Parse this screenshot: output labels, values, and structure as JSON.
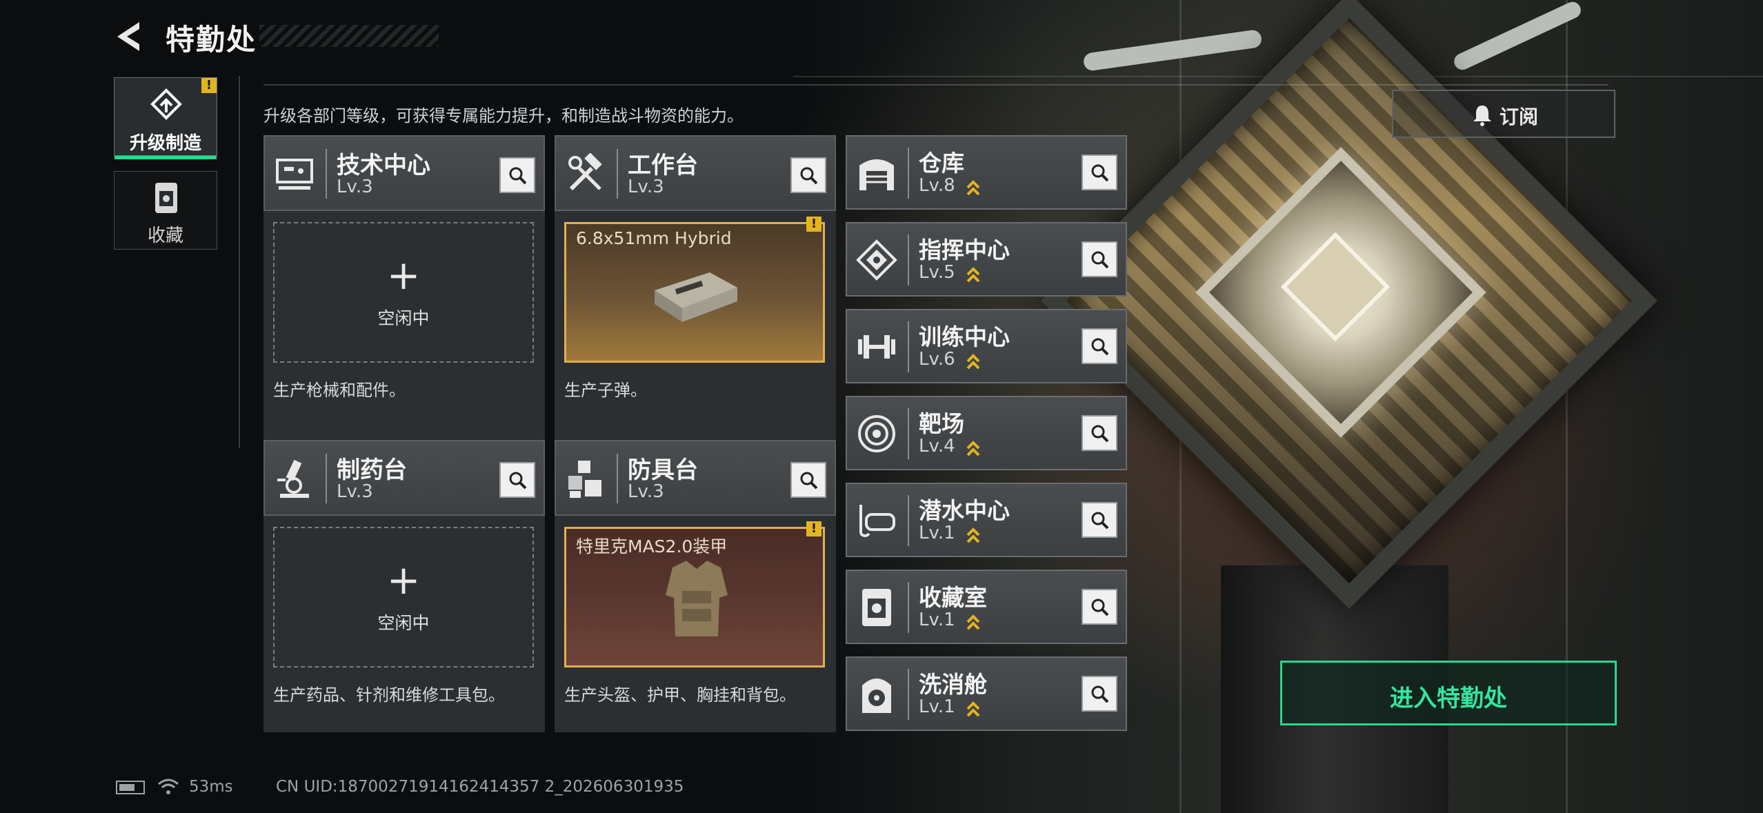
{
  "header": {
    "title": "特勤处",
    "back_icon": "back-arrow-icon"
  },
  "tabs": [
    {
      "label": "升级制造",
      "icon": "upgrade-icon",
      "active": true,
      "badge": "!"
    },
    {
      "label": "收藏",
      "icon": "collection-icon",
      "active": false
    }
  ],
  "description": "升级各部门等级，可获得专属能力提升，和制造战斗物资的能力。",
  "subscribe": {
    "label": "订阅",
    "icon": "bell-icon"
  },
  "stations": [
    {
      "name": "技术中心",
      "level": "Lv.3",
      "icon": "computer-icon",
      "slot": {
        "state": "idle",
        "plus": "+",
        "label": "空闲中"
      },
      "note": "生产枪械和配件。"
    },
    {
      "name": "工作台",
      "level": "Lv.3",
      "icon": "tools-icon",
      "slot": {
        "state": "item",
        "item": "6.8x51mm Hybrid",
        "badge": "!"
      },
      "note": "生产子弹。"
    },
    {
      "name": "制药台",
      "level": "Lv.3",
      "icon": "microscope-icon",
      "slot": {
        "state": "idle",
        "plus": "+",
        "label": "空闲中"
      },
      "note": "生产药品、针剂和维修工具包。"
    },
    {
      "name": "防具台",
      "level": "Lv.3",
      "icon": "armor-blocks-icon",
      "slot": {
        "state": "item",
        "item": "特里克MAS2.0装甲",
        "badge": "!"
      },
      "note": "生产头盔、护甲、胸挂和背包。"
    }
  ],
  "facilities": [
    {
      "name": "仓库",
      "level": "Lv.8",
      "icon": "warehouse-icon"
    },
    {
      "name": "指挥中心",
      "level": "Lv.5",
      "icon": "command-icon"
    },
    {
      "name": "训练中心",
      "level": "Lv.6",
      "icon": "dumbbell-icon"
    },
    {
      "name": "靶场",
      "level": "Lv.4",
      "icon": "target-icon"
    },
    {
      "name": "潜水中心",
      "level": "Lv.1",
      "icon": "diving-mask-icon"
    },
    {
      "name": "收藏室",
      "level": "Lv.1",
      "icon": "collection-room-icon"
    },
    {
      "name": "洗消舱",
      "level": "Lv.1",
      "icon": "decontamination-icon"
    }
  ],
  "enter_button": "进入特勤处",
  "status": {
    "ping": "53ms",
    "uid": "CN UID:18700271914162414357 2_202606301935"
  },
  "colors": {
    "accent": "#27d890",
    "warning": "#e2b420",
    "item_border": "#e0b050"
  }
}
